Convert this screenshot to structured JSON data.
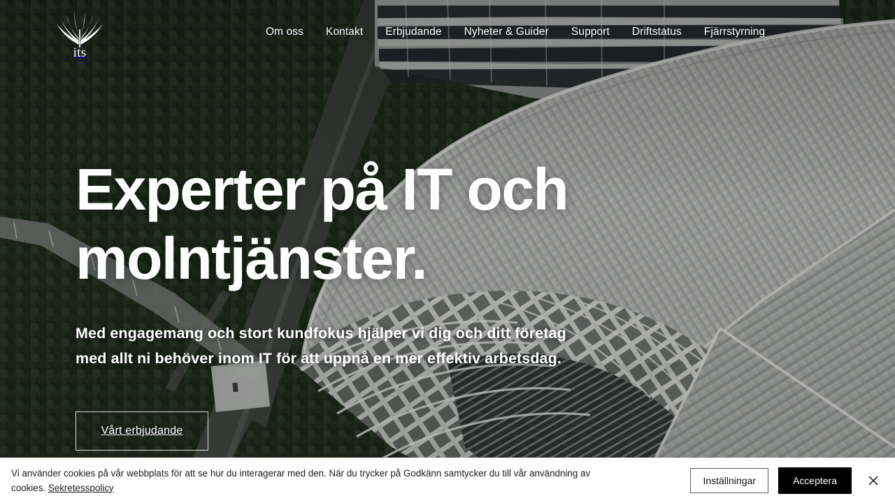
{
  "header": {
    "logo": {
      "icon": "wing-logo-icon",
      "wordmark": "its"
    },
    "nav": [
      {
        "label": "Om oss",
        "name": "nav-link-om-oss"
      },
      {
        "label": "Kontakt",
        "name": "nav-link-kontakt"
      },
      {
        "label": "Erbjudande",
        "name": "nav-link-erbjudande"
      },
      {
        "label": "Nyheter & Guider",
        "name": "nav-link-nyheter-guider"
      },
      {
        "label": "Support",
        "name": "nav-link-support"
      },
      {
        "label": "Driftstatus",
        "name": "nav-link-driftstatus"
      },
      {
        "label": "Fjärrstyrning",
        "name": "nav-link-fjarrstyrning"
      }
    ]
  },
  "hero": {
    "title_line1": "Experter på IT och",
    "title_line2": "molntjänster.",
    "subtitle_line1": "Med engagemang och stort kundfokus hjälper vi dig och ditt företag",
    "subtitle_line2": "med allt ni behöver inom IT för att uppnå en mer effektiv arbetsdag.",
    "cta_label": "Vårt erbjudande"
  },
  "cookie_banner": {
    "text_before_link": "Vi använder cookies på vår webbplats för att se hur du interagerar med den. När du trycker på Godkänn samtycker du till vår användning av cookies. ",
    "link_label": "Sekretesspolicy",
    "settings_label": "Inställningar",
    "accept_label": "Acceptera",
    "close_icon": "close-icon"
  },
  "colors": {
    "accept_button_bg": "#000000",
    "accept_button_text": "#ffffff",
    "settings_button_bg": "#ffffff",
    "settings_button_border": "#5a5a5a",
    "banner_bg": "#ffffff",
    "hero_text": "#ffffff"
  }
}
